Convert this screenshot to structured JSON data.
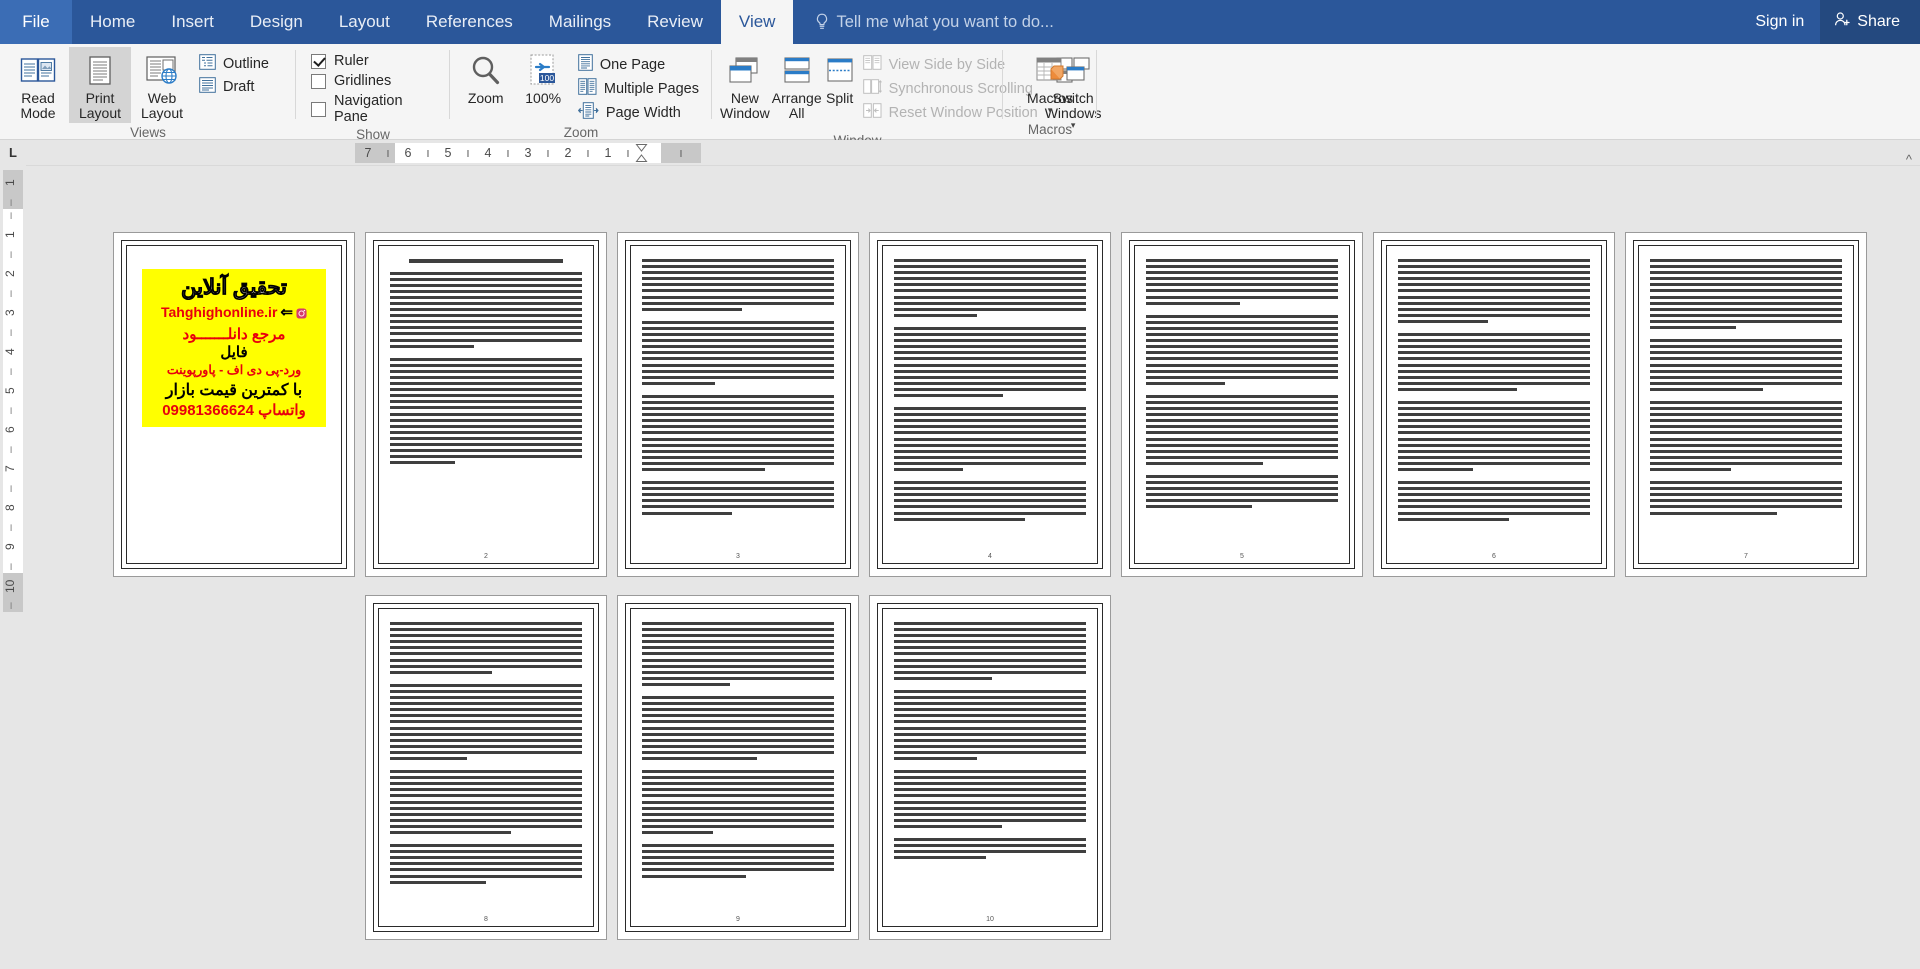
{
  "app": {
    "file_tab": "File",
    "tabs": [
      {
        "label": "Home",
        "active": false
      },
      {
        "label": "Insert",
        "active": false
      },
      {
        "label": "Design",
        "active": false
      },
      {
        "label": "Layout",
        "active": false
      },
      {
        "label": "References",
        "active": false
      },
      {
        "label": "Mailings",
        "active": false
      },
      {
        "label": "Review",
        "active": false
      },
      {
        "label": "View",
        "active": true
      }
    ],
    "tell_me": "Tell me what you want to do...",
    "sign_in": "Sign in",
    "share": "Share",
    "tell_me_icon": "lightbulb-icon",
    "share_icon": "person-add-icon"
  },
  "ribbon": {
    "groups": [
      {
        "name": "views",
        "label": "Views",
        "buttons": [
          {
            "label": "Read\nMode",
            "icon": "read-mode-icon",
            "selected": false
          },
          {
            "label": "Print\nLayout",
            "icon": "print-layout-icon",
            "selected": true
          },
          {
            "label": "Web\nLayout",
            "icon": "web-layout-icon",
            "selected": false
          }
        ],
        "small_items": [
          {
            "label": "Outline",
            "icon": "outline-icon",
            "disabled": false
          },
          {
            "label": "Draft",
            "icon": "draft-icon",
            "disabled": false
          }
        ]
      },
      {
        "name": "show",
        "label": "Show",
        "checkboxes": [
          {
            "label": "Ruler",
            "checked": true
          },
          {
            "label": "Gridlines",
            "checked": false
          },
          {
            "label": "Navigation Pane",
            "checked": false
          }
        ]
      },
      {
        "name": "zoom",
        "label": "Zoom",
        "buttons": [
          {
            "label": "Zoom",
            "icon": "magnifier-icon",
            "selected": false
          },
          {
            "label": "100%",
            "icon": "zoom-100-icon",
            "selected": false
          }
        ],
        "small_items": [
          {
            "label": "One Page",
            "icon": "one-page-icon",
            "disabled": false
          },
          {
            "label": "Multiple Pages",
            "icon": "multiple-pages-icon",
            "disabled": false
          },
          {
            "label": "Page Width",
            "icon": "page-width-icon",
            "disabled": false
          }
        ]
      },
      {
        "name": "window",
        "label": "Window",
        "buttons": [
          {
            "label": "New\nWindow",
            "icon": "new-window-icon",
            "selected": false
          },
          {
            "label": "Arrange\nAll",
            "icon": "arrange-all-icon",
            "selected": false
          },
          {
            "label": "Split",
            "icon": "split-icon",
            "selected": false
          }
        ],
        "small_items": [
          {
            "label": "View Side by Side",
            "icon": "side-by-side-icon",
            "disabled": true
          },
          {
            "label": "Synchronous Scrolling",
            "icon": "sync-scroll-icon",
            "disabled": true
          },
          {
            "label": "Reset Window Position",
            "icon": "reset-window-icon",
            "disabled": true
          }
        ],
        "dropdown_buttons": [
          {
            "label": "Switch\nWindows",
            "icon": "switch-windows-icon"
          }
        ]
      },
      {
        "name": "macros",
        "label": "Macros",
        "dropdown_buttons": [
          {
            "label": "Macros",
            "icon": "macros-icon"
          }
        ]
      }
    ]
  },
  "ruler": {
    "tab_stop_marker": "L",
    "horizontal_numbers": [
      "7",
      "6",
      "5",
      "4",
      "3",
      "2",
      "1"
    ],
    "vertical_numbers": [
      "1",
      "1",
      "2",
      "3",
      "4",
      "5",
      "6",
      "7",
      "8",
      "9",
      "10"
    ]
  },
  "document": {
    "view_mode": "Multiple Pages",
    "total_pages": 10,
    "language_direction": "rtl",
    "banner": {
      "title": "تحقیق آنلاین",
      "site": "Tahghighonline.ir",
      "line3": "مرجع دانلـــــــود",
      "line4": "فایل",
      "line5": "ورد-پی دی اف - پاورپوینت",
      "line6": "با کمترین قیمت بازار",
      "phone": "09981366624",
      "whatsapp": "واتساپ",
      "highlight_color": "#ffff00",
      "accent_color": "#e8000d"
    },
    "page_heading_p2": "مــــــــقدمـــــــــه : مــــــــــعارفه و قـــــــدری",
    "pages": [
      {
        "number": 1,
        "type": "banner",
        "page_label": ""
      },
      {
        "number": 2,
        "type": "text",
        "page_label": "2",
        "has_heading": true,
        "paragraphs": [
          13,
          18
        ]
      },
      {
        "number": 3,
        "type": "text",
        "page_label": "3",
        "has_heading": false,
        "paragraphs": [
          9,
          11,
          13
        ]
      },
      {
        "number": 4,
        "type": "text",
        "page_label": "4",
        "has_heading": false,
        "paragraphs": [
          10,
          12,
          11
        ]
      },
      {
        "number": 5,
        "type": "text",
        "page_label": "5",
        "has_heading": false,
        "paragraphs": [
          8,
          12,
          12
        ]
      },
      {
        "number": 6,
        "type": "text",
        "page_label": "6",
        "has_heading": false,
        "paragraphs": [
          11,
          10,
          12
        ]
      },
      {
        "number": 7,
        "type": "text",
        "page_label": "7",
        "has_heading": false,
        "paragraphs": [
          12,
          9,
          12
        ]
      },
      {
        "number": 8,
        "type": "text",
        "page_label": "8",
        "has_heading": false,
        "paragraphs": [
          9,
          13,
          11
        ]
      },
      {
        "number": 9,
        "type": "text",
        "page_label": "9",
        "has_heading": false,
        "paragraphs": [
          11,
          11,
          11
        ]
      },
      {
        "number": 10,
        "type": "text",
        "page_label": "10",
        "has_heading": false,
        "paragraphs": [
          10,
          12,
          10
        ]
      }
    ]
  }
}
